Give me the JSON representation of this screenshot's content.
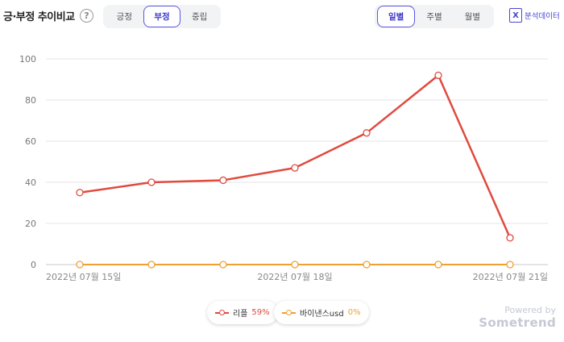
{
  "header": {
    "title": "긍·부정 추이비교",
    "help_symbol": "?",
    "tone_tabs": [
      {
        "label": "긍정",
        "active": false
      },
      {
        "label": "부정",
        "active": true
      },
      {
        "label": "중립",
        "active": false
      }
    ],
    "period_tabs": [
      {
        "label": "일별",
        "active": true
      },
      {
        "label": "주별",
        "active": false
      },
      {
        "label": "월별",
        "active": false
      }
    ],
    "export_label": "분석데이터",
    "export_icon": "excel-icon"
  },
  "colors": {
    "accent": "#5b55e0",
    "series_1": "#e04a3f",
    "series_2": "#f0a030"
  },
  "chart_data": {
    "type": "line",
    "x": [
      "2022-07-15",
      "2022-07-16",
      "2022-07-17",
      "2022-07-18",
      "2022-07-19",
      "2022-07-20",
      "2022-07-21"
    ],
    "x_tick_labels": [
      "2022년 07월 15일",
      "2022년 07월 18일",
      "2022년 07월 21일"
    ],
    "x_tick_dates": [
      "2022-07-15",
      "2022-07-18",
      "2022-07-21"
    ],
    "y_ticks": [
      0,
      20,
      40,
      60,
      80,
      100
    ],
    "ylim": [
      0,
      100
    ],
    "grid": true,
    "legend_position": "bottom-center",
    "series": [
      {
        "name": "리플",
        "share": "59%",
        "values": [
          35,
          40,
          41,
          47,
          64,
          92,
          13
        ]
      },
      {
        "name": "바이낸스usd",
        "share": "0%",
        "values": [
          0,
          0,
          0,
          0,
          0,
          0,
          0
        ]
      }
    ]
  },
  "footer": {
    "powered_by": "Powered by",
    "brand": "Sometrend"
  }
}
